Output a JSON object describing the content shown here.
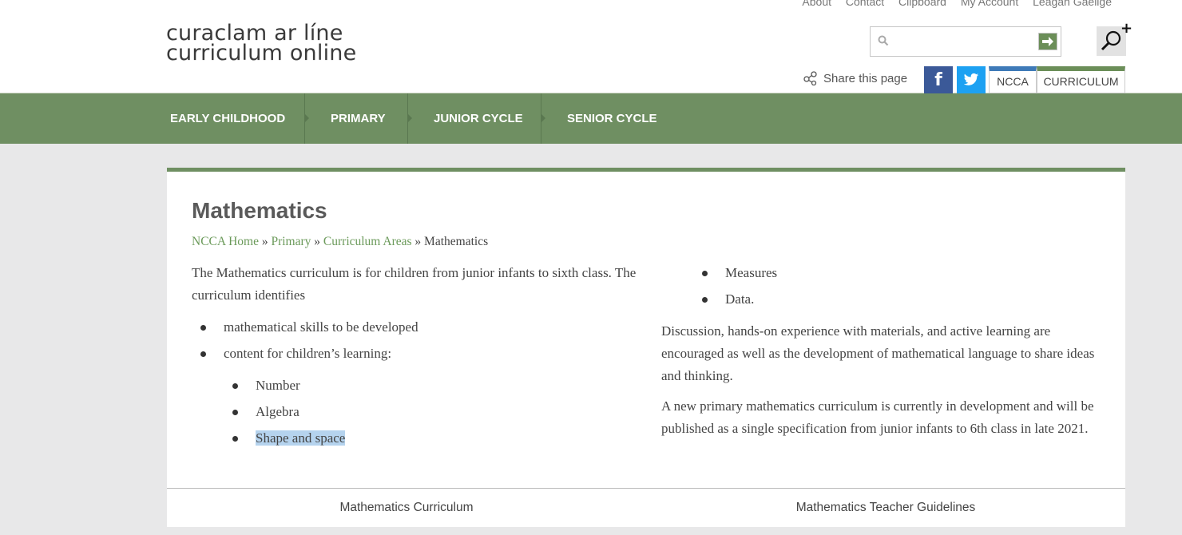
{
  "top_links": [
    "About",
    "Contact",
    "Clipboard",
    "My Account",
    "Leagan Gaeilge"
  ],
  "logo": {
    "line1": "curaclam ar líne",
    "line2": "curriculum online"
  },
  "search": {
    "placeholder": ""
  },
  "share": {
    "label": "Share this page"
  },
  "site_tabs": {
    "ncca": "NCCA",
    "curriculum": "CURRICULUM"
  },
  "nav": [
    "EARLY CHILDHOOD",
    "PRIMARY",
    "JUNIOR CYCLE",
    "SENIOR CYCLE"
  ],
  "main": {
    "title": "Mathematics",
    "breadcrumb": [
      {
        "label": "NCCA Home",
        "link": true
      },
      {
        "label": "Primary",
        "link": true
      },
      {
        "label": "Curriculum Areas",
        "link": true
      },
      {
        "label": "Mathematics",
        "link": false
      }
    ],
    "breadcrumb_sep": "»",
    "intro": "The Mathematics curriculum is for children from junior infants to sixth class. The curriculum identifies",
    "bullets": [
      "mathematical skills to be developed",
      "content for children’s learning:"
    ],
    "content_strands": [
      "Number",
      "Algebra",
      "Shape and space",
      "Measures",
      "Data."
    ],
    "para1": "Discussion, hands-on experience with materials, and active learning are encouraged as well as the development of mathematical language to share ideas and thinking.",
    "para2": "A new primary mathematics curriculum is currently in development and will be published as a single specification from junior infants to 6th class in late 2021."
  },
  "bottom_tabs": [
    "Mathematics Curriculum",
    "Mathematics Teacher Guidelines"
  ],
  "colors": {
    "nav_green": "#6f8f62",
    "link_green": "#6b9a5a",
    "facebook": "#3b5998",
    "twitter": "#1da1f2",
    "ncca_blue": "#3e7ab8",
    "selection": "#b5d3ee"
  }
}
